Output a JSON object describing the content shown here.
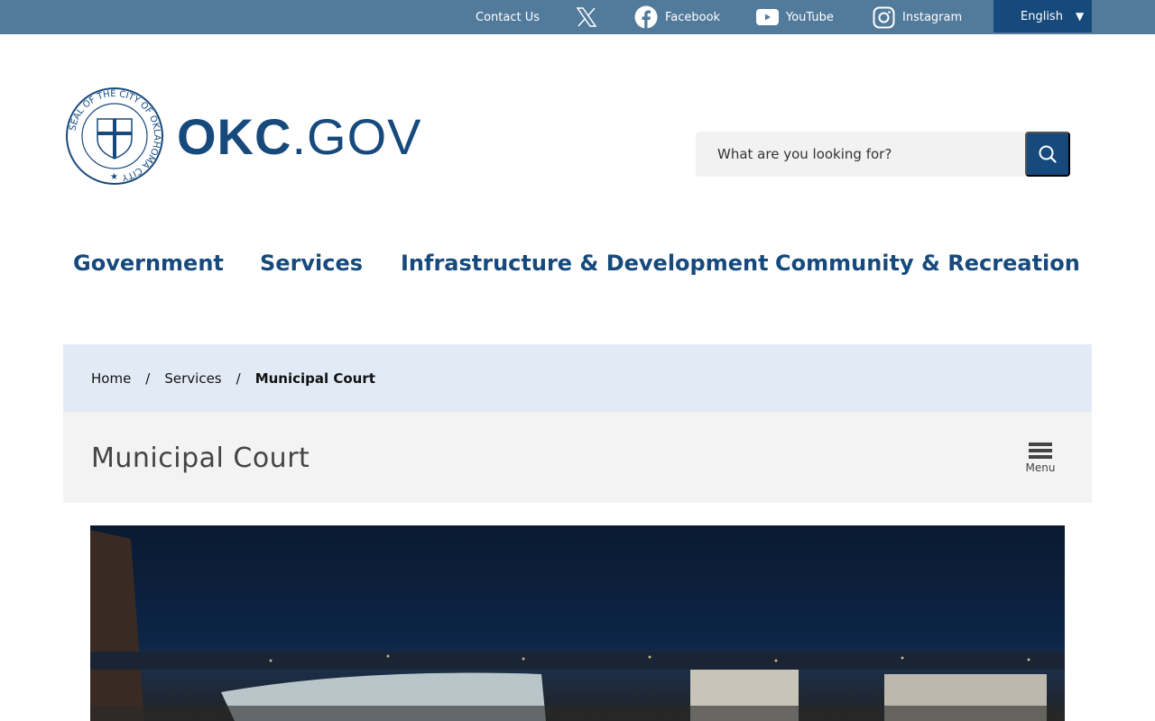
{
  "topbar": {
    "contact": "Contact Us",
    "facebook": "Facebook",
    "youtube": "YouTube",
    "instagram": "Instagram",
    "language": "English"
  },
  "logo": {
    "seal_text": "SEAL OF THE CITY OF OKLAHOMA CITY",
    "brand_bold": "OKC",
    "brand_light": ".GOV"
  },
  "search": {
    "placeholder": "What are you looking for?"
  },
  "nav": [
    "Government",
    "Services",
    "Infrastructure & Development",
    "Community & Recreation"
  ],
  "breadcrumb": {
    "home": "Home",
    "services": "Services",
    "current": "Municipal Court",
    "separator": "/"
  },
  "page": {
    "title": "Municipal Court",
    "menu_label": "Menu"
  },
  "colors": {
    "topbar": "#527a9b",
    "brand": "#174a7c",
    "breadcrumb_bg": "#e2ebf5",
    "title_bg": "#f3f3f3"
  }
}
